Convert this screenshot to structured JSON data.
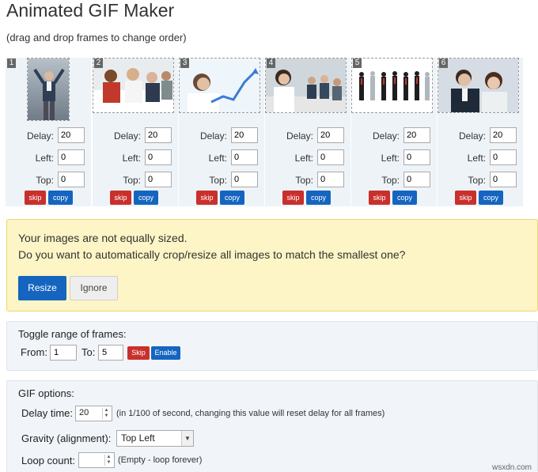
{
  "header": {
    "title": "Animated GIF Maker",
    "subtitle": "(drag and drop frames to change order)"
  },
  "frames": [
    {
      "number": "1",
      "delay": "20",
      "left": "0",
      "top": "0"
    },
    {
      "number": "2",
      "delay": "20",
      "left": "0",
      "top": "0"
    },
    {
      "number": "3",
      "delay": "20",
      "left": "0",
      "top": "0"
    },
    {
      "number": "4",
      "delay": "20",
      "left": "0",
      "top": "0"
    },
    {
      "number": "5",
      "delay": "20",
      "left": "0",
      "top": "0"
    },
    {
      "number": "6",
      "delay": "20",
      "left": "0",
      "top": "0"
    }
  ],
  "frame_labels": {
    "delay": "Delay:",
    "left": "Left:",
    "top": "Top:",
    "skip": "skip",
    "copy": "copy"
  },
  "warning": {
    "line1": "Your images are not equally sized.",
    "line2": "Do you want to automatically crop/resize all images to match the smallest one?",
    "resize_label": "Resize",
    "ignore_label": "Ignore"
  },
  "toggle_range": {
    "title": "Toggle range of frames:",
    "from_label": "From:",
    "from_value": "1",
    "to_label": "To:",
    "to_value": "5",
    "skip_label": "Skip",
    "enable_label": "Enable"
  },
  "gif_options": {
    "title": "GIF options:",
    "delay_label": "Delay time:",
    "delay_value": "20",
    "delay_note": "(in 1/100 of second, changing this value will reset delay for all frames)",
    "gravity_label": "Gravity (alignment):",
    "gravity_value": "Top Left",
    "loop_label": "Loop count:",
    "loop_value": "",
    "loop_note": "(Empty - loop forever)"
  },
  "watermark": "wsxdn.com",
  "colors": {
    "skip_red": "#c9302c",
    "copy_blue": "#1565c0",
    "warning_bg": "#fdf5c5",
    "warning_border": "#e9d770",
    "panel_bg": "#f1f4f8"
  }
}
